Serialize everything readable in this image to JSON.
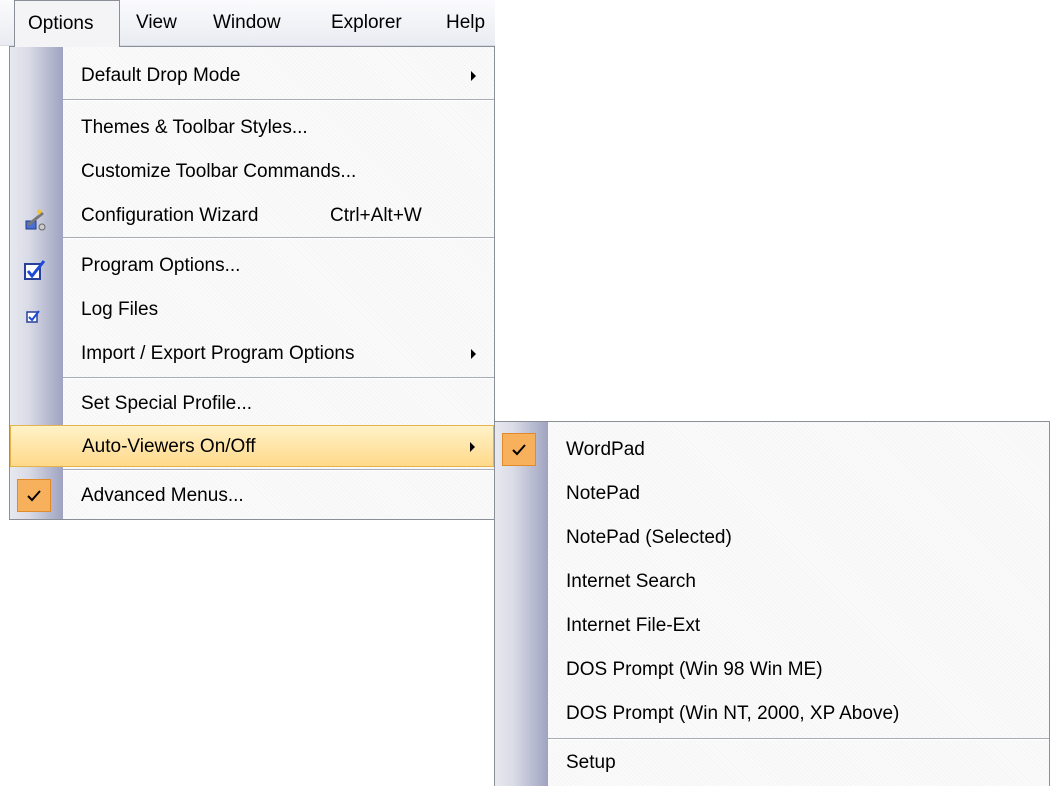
{
  "menubar": {
    "items": [
      {
        "label": "Options"
      },
      {
        "label": "View"
      },
      {
        "label": "Window"
      },
      {
        "label": "Explorer"
      },
      {
        "label": "Help"
      }
    ]
  },
  "options_menu": {
    "items": [
      {
        "label": "Default Drop Mode"
      },
      {
        "label": "Themes & Toolbar Styles..."
      },
      {
        "label": "Customize Toolbar Commands..."
      },
      {
        "label": "Configuration Wizard",
        "accel": "Ctrl+Alt+W",
        "icon": "wizard-icon"
      },
      {
        "label": "Program Options...",
        "icon": "checkbox-icon"
      },
      {
        "label": "Log Files",
        "icon": "small-checkbox-icon"
      },
      {
        "label": "Import / Export Program Options"
      },
      {
        "label": "Set Special Profile..."
      },
      {
        "label": "Auto-Viewers On/Off"
      },
      {
        "label": "Advanced Menus...",
        "icon": "checkmark-icon"
      }
    ]
  },
  "auto_viewers_submenu": {
    "items": [
      {
        "label": "WordPad",
        "icon": "checkmark-icon"
      },
      {
        "label": "NotePad"
      },
      {
        "label": "NotePad (Selected)"
      },
      {
        "label": "Internet Search"
      },
      {
        "label": "Internet File-Ext"
      },
      {
        "label": "DOS Prompt (Win 98  Win ME)"
      },
      {
        "label": "DOS Prompt (Win NT, 2000, XP  Above)"
      },
      {
        "label": "Setup"
      }
    ]
  },
  "colors": {
    "highlight_border": "#e5b34d",
    "check_fill": "#f7b05c",
    "menu_border": "#8a8f98"
  }
}
